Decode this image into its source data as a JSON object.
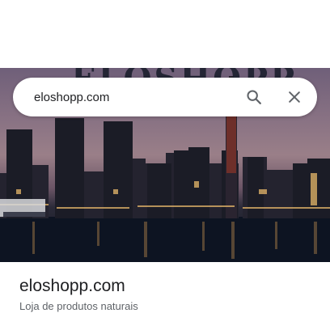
{
  "search": {
    "value": "eloshopp.com",
    "search_icon": "search-icon",
    "close_icon": "close-icon"
  },
  "hero": {
    "brand_partial_text": "ELOSHOPP",
    "image_subject": "city-skyline-at-dusk"
  },
  "result": {
    "title": "eloshopp.com",
    "subtitle": "Loja de produtos naturais"
  },
  "colors": {
    "text_primary": "#202124",
    "text_secondary": "#5f6368",
    "icon": "#5f6368",
    "background": "#ffffff"
  }
}
